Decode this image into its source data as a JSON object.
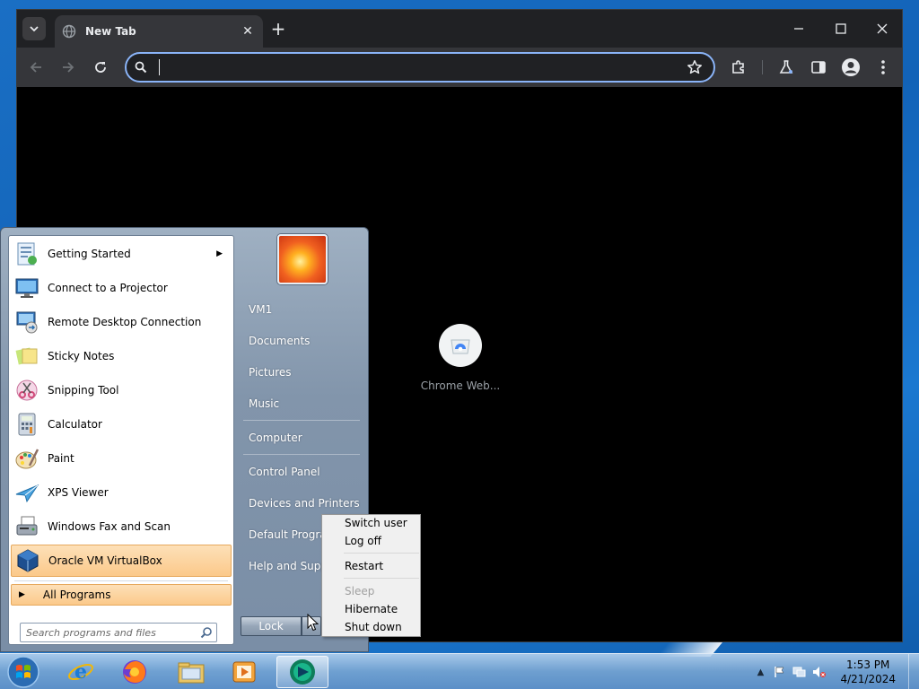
{
  "browser": {
    "tab_title": "New Tab",
    "omnibox_value": "",
    "omnibox_placeholder": "",
    "shortcut_label": "Chrome Web..."
  },
  "start_menu": {
    "programs": [
      {
        "label": "Getting Started",
        "icon": "getting-started-icon",
        "has_submenu": true
      },
      {
        "label": "Connect to a Projector",
        "icon": "projector-icon"
      },
      {
        "label": "Remote Desktop Connection",
        "icon": "remote-desktop-icon"
      },
      {
        "label": "Sticky Notes",
        "icon": "sticky-notes-icon"
      },
      {
        "label": "Snipping Tool",
        "icon": "snipping-tool-icon"
      },
      {
        "label": "Calculator",
        "icon": "calculator-icon"
      },
      {
        "label": "Paint",
        "icon": "paint-icon"
      },
      {
        "label": "XPS Viewer",
        "icon": "xps-viewer-icon"
      },
      {
        "label": "Windows Fax and Scan",
        "icon": "fax-scan-icon"
      },
      {
        "label": "Oracle VM VirtualBox",
        "icon": "virtualbox-icon",
        "highlighted": true
      }
    ],
    "all_programs": "All Programs",
    "search_placeholder": "Search programs and files",
    "right_items": {
      "user": "VM1",
      "documents": "Documents",
      "pictures": "Pictures",
      "music": "Music",
      "computer": "Computer",
      "control_panel": "Control Panel",
      "devices": "Devices and Printers",
      "default_programs": "Default Programs",
      "help": "Help and Support"
    },
    "lock_label": "Lock"
  },
  "power_menu": {
    "switch_user": "Switch user",
    "log_off": "Log off",
    "restart": "Restart",
    "sleep": "Sleep",
    "hibernate": "Hibernate",
    "shut_down": "Shut down"
  },
  "taskbar": {
    "time": "1:53 PM",
    "date": "4/21/2024"
  },
  "colors": {
    "chrome_dark": "#202124",
    "chrome_toolbar": "#35363a",
    "omnibox_focus": "#8ab4f8",
    "start_highlight": "#fbc98a"
  }
}
